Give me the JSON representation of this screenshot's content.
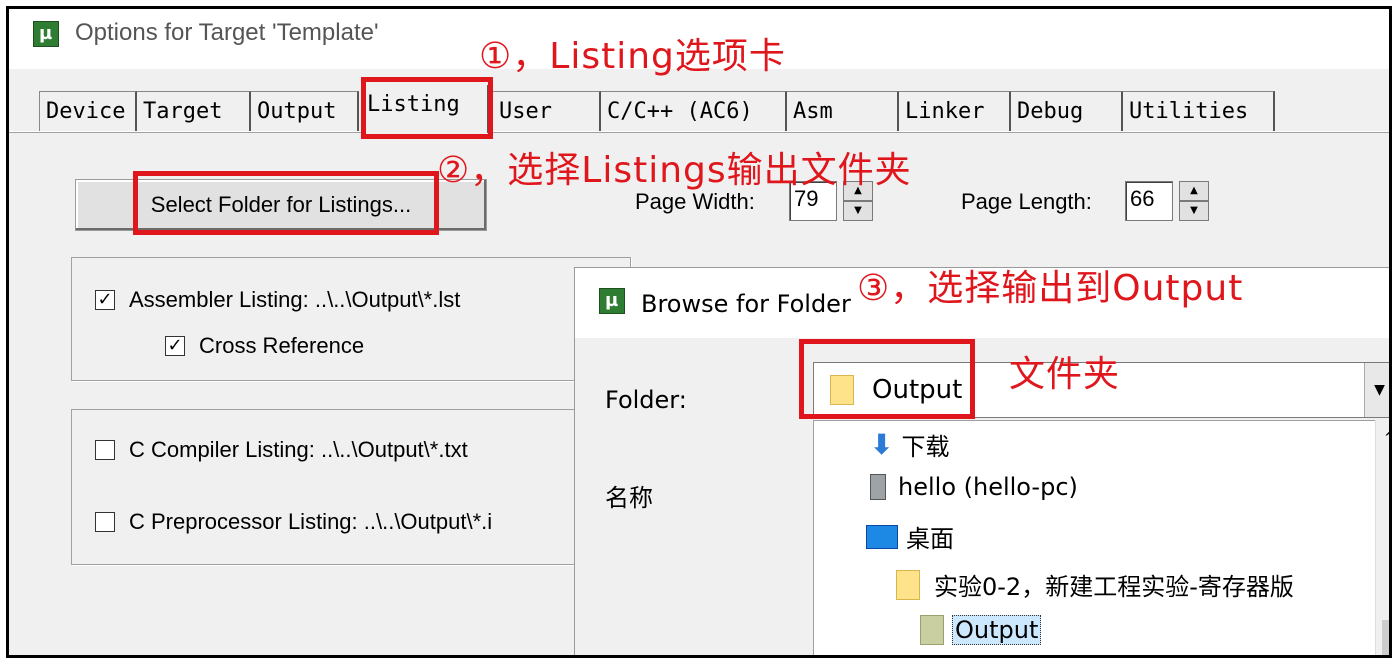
{
  "window": {
    "title": "Options for Target 'Template'"
  },
  "tabs": [
    {
      "label": "Device"
    },
    {
      "label": "Target"
    },
    {
      "label": "Output"
    },
    {
      "label": "Listing"
    },
    {
      "label": "User"
    },
    {
      "label": "C/C++ (AC6)"
    },
    {
      "label": "Asm"
    },
    {
      "label": "Linker"
    },
    {
      "label": "Debug"
    },
    {
      "label": "Utilities"
    }
  ],
  "listing": {
    "select_folder_label": "Select Folder for Listings...",
    "page_width_label": "Page Width:",
    "page_width_value": "79",
    "page_length_label": "Page Length:",
    "page_length_value": "66",
    "assembler_listing": {
      "label": "Assembler Listing:  ..\\..\\Output\\*.lst",
      "checked": true
    },
    "cross_reference": {
      "label": "Cross Reference",
      "checked": true
    },
    "c_compiler_listing": {
      "label": "C Compiler Listing:  ..\\..\\Output\\*.txt",
      "checked": false
    },
    "c_preprocessor_listing": {
      "label": "C Preprocessor Listing:  ..\\..\\Output\\*.i",
      "checked": false
    }
  },
  "browse": {
    "title": "Browse for Folder",
    "folder_label": "Folder:",
    "folder_value": "Output",
    "name_label": "名称",
    "tree": [
      {
        "label": "下载",
        "icon": "download-arrow-icon"
      },
      {
        "label": "hello (hello-pc)",
        "icon": "computer-icon"
      },
      {
        "label": "桌面",
        "icon": "desktop-icon"
      },
      {
        "label": "实验0-2，新建工程实验-寄存器版",
        "icon": "folder-icon"
      },
      {
        "label": "Output",
        "icon": "folder-icon",
        "selected": true
      }
    ]
  },
  "annotations": {
    "step1": "①，Listing选项卡",
    "step2": "②，选择Listings输出文件夹",
    "step3_line1": "③，选择输出到Output",
    "step3_line2": "文件夹"
  },
  "colors": {
    "annotation": "#e0161d",
    "dialog_bg": "#f0f0f0",
    "selection": "#cce8ff"
  }
}
